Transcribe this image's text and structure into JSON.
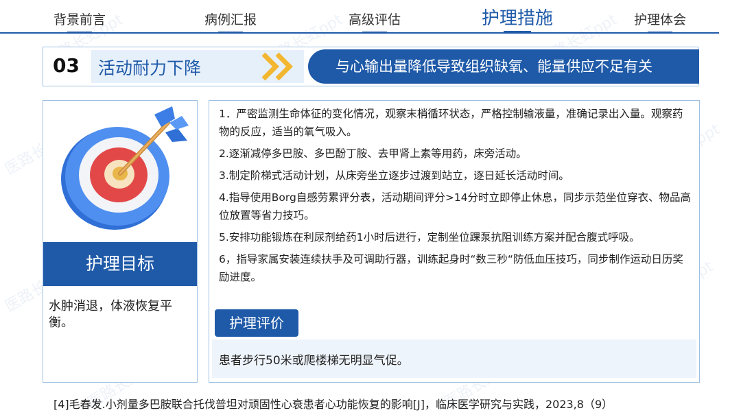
{
  "nav": {
    "items": [
      {
        "label": "背景前言"
      },
      {
        "label": "病例汇报"
      },
      {
        "label": "高级评估"
      },
      {
        "label": "护理措施"
      },
      {
        "label": "护理体会"
      }
    ],
    "active_index": 3
  },
  "title": {
    "number": "03",
    "name": "活动耐力下降",
    "cause": "与心输出量降低导致组织缺氧、能量供应不足有关"
  },
  "goal": {
    "label": "护理目标",
    "text": "水肿消退，体液恢复平衡。"
  },
  "measures": [
    "1．严密监测生命体征的变化情况，观察末梢循环状态，严格控制输液量，准确记录出入量。观察药物的反应，适当的氧气吸入。",
    "2.逐渐减停多巴胺、多巴酚丁胺、去甲肾上素等用药，床旁活动。",
    "3.制定阶梯式活动计划，从床旁坐立逐步过渡到站立，逐日延长活动时间。",
    "4.指导使用Borg自感劳累评分表，活动期间评分>14分时立即停止休息，同步示范坐位穿衣、物品高位放置等省力技巧。",
    "5.安排功能锻炼在利尿剂给药1小时后进行，定制坐位踝泵抗阻训练方案并配合腹式呼吸。",
    "6，指导家属安装连续扶手及可调助行器，训练起身时“数三秒“防低血压技巧，同步制作运动日历奖励进度。"
  ],
  "evaluation": {
    "label": "护理评价",
    "text": "患者步行50米或爬楼梯无明显气促。"
  },
  "reference": "[4]毛春发.小剂量多巴胺联合托伐普坦对顽固性心衰患者心功能恢复的影响[J]，临床医学研究与实践，2023,8（9）",
  "watermark": "医路长虹ppt",
  "colors": {
    "primary": "#1f5aa8",
    "light": "#e6f0fb",
    "border": "#9fbfe2"
  }
}
